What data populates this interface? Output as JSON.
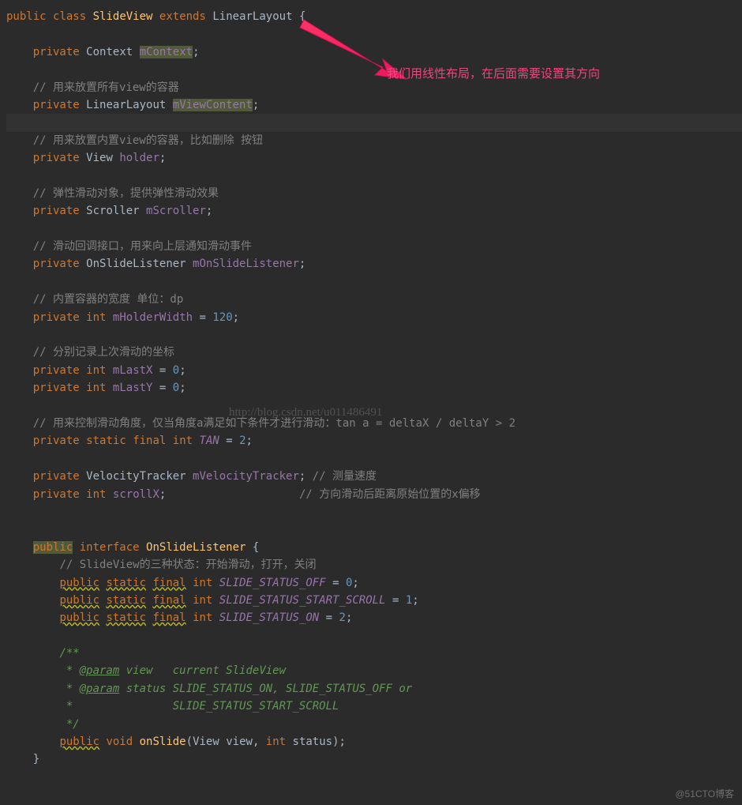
{
  "code": {
    "l1_public": "public",
    "l1_class": "class",
    "l1_name": "SlideView",
    "l1_extends": "extends",
    "l1_parent": "LinearLayout",
    "l1_brace": " {",
    "l2_priv": "private",
    "l2_type": "Context",
    "l2_field": "mContext",
    "c1": "// 用来放置所有view的容器",
    "l3_priv": "private",
    "l3_type": "LinearLayout",
    "l3_field": "mViewContent",
    "c2": "// 用来放置内置view的容器，比如删除 按钮",
    "l4_priv": "private",
    "l4_type": "View",
    "l4_field": "holder",
    "c3": "// 弹性滑动对象，提供弹性滑动效果",
    "l5_priv": "private",
    "l5_type": "Scroller",
    "l5_field": "mScroller",
    "c4": "// 滑动回调接口，用来向上层通知滑动事件",
    "l6_priv": "private",
    "l6_type": "OnSlideListener",
    "l6_field": "mOnSlideListener",
    "c5": "// 内置容器的宽度 单位：dp",
    "l7_priv": "private",
    "l7_int": "int",
    "l7_field": "mHolderWidth",
    "l7_eq": " = ",
    "l7_val": "120",
    "c6": "// 分别记录上次滑动的坐标",
    "l8_priv": "private",
    "l8_int": "int",
    "l8_field": "mLastX",
    "l8_eq": " = ",
    "l8_val": "0",
    "l9_priv": "private",
    "l9_int": "int",
    "l9_field": "mLastY",
    "l9_eq": " = ",
    "l9_val": "0",
    "c7": "// 用来控制滑动角度，仅当角度a满足如下条件才进行滑动：tan a = deltaX / deltaY > 2",
    "l10_priv": "private",
    "l10_static": "static",
    "l10_final": "final",
    "l10_int": "int",
    "l10_field": "TAN",
    "l10_eq": " = ",
    "l10_val": "2",
    "l11_priv": "private",
    "l11_type": "VelocityTracker",
    "l11_field": "mVelocityTracker",
    "c8": "// 测量速度",
    "l12_priv": "private",
    "l12_int": "int",
    "l12_field": "scrollX",
    "c9": "// 方向滑动后距离原始位置的x偏移",
    "l13_public": "public",
    "l13_interface": "interface",
    "l13_name": "OnSlideListener",
    "l13_brace": " {",
    "c10": "// SlideView的三种状态：开始滑动，打开，关闭",
    "l14_public": "public",
    "l14_static": "static",
    "l14_final": "final",
    "l14_int": "int",
    "l14_field": "SLIDE_STATUS_OFF",
    "l14_eq": " = ",
    "l14_val": "0",
    "l15_public": "public",
    "l15_static": "static",
    "l15_final": "final",
    "l15_int": "int",
    "l15_field": "SLIDE_STATUS_START_SCROLL",
    "l15_eq": " = ",
    "l15_val": "1",
    "l16_public": "public",
    "l16_static": "static",
    "l16_final": "final",
    "l16_int": "int",
    "l16_field": "SLIDE_STATUS_ON",
    "l16_eq": " = ",
    "l16_val": "2",
    "doc1": "/**",
    "doc2_star": " * ",
    "doc2_tag": "@param",
    "doc2_rest": " view   current SlideView",
    "doc3_star": " * ",
    "doc3_tag": "@param",
    "doc3_rest": " status SLIDE_STATUS_ON, SLIDE_STATUS_OFF or",
    "doc4": " *               SLIDE_STATUS_START_SCROLL",
    "doc5": " */",
    "m1_public": "public",
    "m1_void": "void",
    "m1_name": "onSlide",
    "m1_paren": "(",
    "m1_t1": "View",
    "m1_p1": " view",
    "m1_comma": ", ",
    "m1_t2": "int",
    "m1_p2": " status",
    "m1_close": ");",
    "close_brace": "}"
  },
  "annotation": "我们用线性布局，在后面需要设置其方向",
  "watermark_center": "http://blog.csdn.net/u011486491",
  "watermark_corner": "@51CTO博客"
}
